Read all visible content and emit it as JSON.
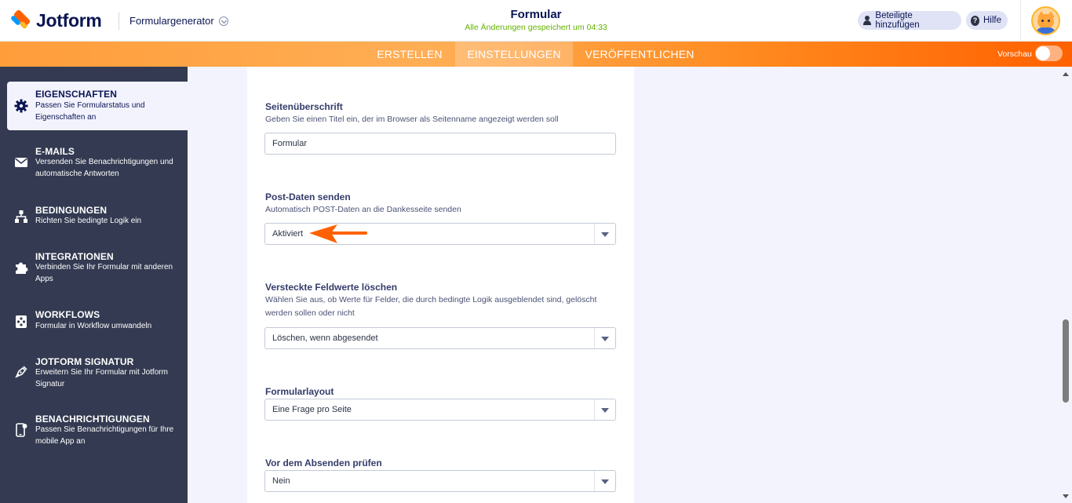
{
  "header": {
    "logo_text": "Jotform",
    "app_name": "Formulargenerator",
    "form_title": "Formular",
    "save_status": "Alle Änderungen gespeichert um 04:33",
    "share_label": "Beteiligte hinzufügen",
    "help_label": "Hilfe"
  },
  "nav": {
    "tabs": [
      {
        "label": "ERSTELLEN",
        "active": false
      },
      {
        "label": "EINSTELLUNGEN",
        "active": true
      },
      {
        "label": "VERÖFFENTLICHEN",
        "active": false
      }
    ],
    "preview_label": "Vorschau",
    "preview_on": false
  },
  "sidebar": {
    "items": [
      {
        "title": "EIGENSCHAFTEN",
        "desc": "Passen Sie Formularstatus und Eigenschaften an",
        "icon": "gear-icon",
        "active": true
      },
      {
        "title": "E-MAILS",
        "desc": "Versenden Sie Benachrichtigungen und automatische Antworten",
        "icon": "envelope-icon",
        "active": false
      },
      {
        "title": "BEDINGUNGEN",
        "desc": "Richten Sie bedingte Logik ein",
        "icon": "sitemap-icon",
        "active": false
      },
      {
        "title": "INTEGRATIONEN",
        "desc": "Verbinden Sie Ihr Formular mit anderen Apps",
        "icon": "puzzle-icon",
        "active": false
      },
      {
        "title": "WORKFLOWS",
        "desc": "Formular in Workflow umwandeln",
        "icon": "workflow-icon",
        "active": false
      },
      {
        "title": "JOTFORM SIGNATUR",
        "desc": "Erweitern Sie Ihr Formular mit Jotform Signatur",
        "icon": "pen-nib-icon",
        "active": false
      },
      {
        "title": "BENACHRICHTIGUNGEN",
        "desc": "Passen Sie Benachrichtigungen für Ihre mobile App an",
        "icon": "mobile-notification-icon",
        "active": false
      }
    ]
  },
  "settings": {
    "page_title": {
      "label": "Seitenüberschrift",
      "help": "Geben Sie einen Titel ein, der im Browser als Seitenname angezeigt werden soll",
      "value": "Formular"
    },
    "post_data": {
      "label": "Post-Daten senden",
      "help": "Automatisch POST-Daten an die Dankesseite senden",
      "value": "Aktiviert"
    },
    "clear_hidden": {
      "label": "Versteckte Feldwerte löschen",
      "help": "Wählen Sie aus, ob Werte für Felder, die durch bedingte Logik ausgeblendet sind, gelöscht werden sollen oder nicht",
      "value": "Löschen, wenn abgesendet"
    },
    "form_layout": {
      "label": "Formularlayout",
      "value": "Eine Frage pro Seite"
    },
    "review_before_submit": {
      "label": "Vor dem Absenden prüfen",
      "value": "Nein"
    }
  },
  "colors": {
    "accent": "#ff6100",
    "sidebar_bg": "#333a51",
    "success": "#64b200"
  }
}
